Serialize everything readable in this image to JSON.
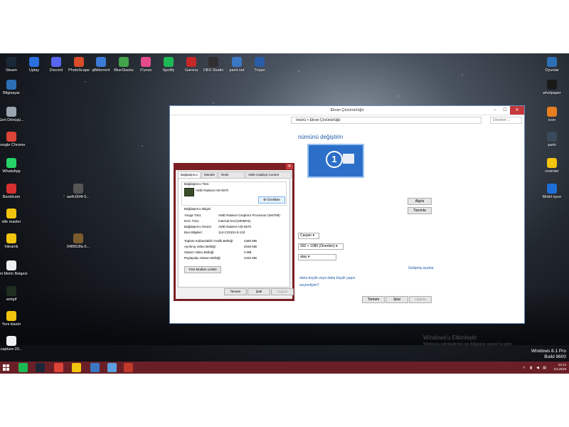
{
  "desktop": {
    "top_icons": [
      {
        "label": "Steam",
        "color": "#1b2838"
      },
      {
        "label": "Uplay",
        "color": "#2a6fdb"
      },
      {
        "label": "Discord",
        "color": "#5865f2"
      },
      {
        "label": "PhotoScape",
        "color": "#d94c2a"
      },
      {
        "label": "qBittorrent",
        "color": "#3a7bd5"
      },
      {
        "label": "BlueStacks",
        "color": "#44a34a"
      },
      {
        "label": "iTunes",
        "color": "#e54b8c"
      },
      {
        "label": "Spotify",
        "color": "#1db954"
      },
      {
        "label": "Garena",
        "color": "#c62828"
      },
      {
        "label": "OBS Studio",
        "color": "#302e31"
      },
      {
        "label": "paint.net",
        "color": "#3b78c4"
      },
      {
        "label": "Trojan",
        "color": "#2a5ca8"
      }
    ],
    "left_icons": [
      {
        "label": "Bilgisayar",
        "color": "#2d6fb5"
      },
      {
        "label": "Geri Dönüşü...",
        "color": "#9aa5b1"
      },
      {
        "label": "Google Chrome",
        "color": "#db4437"
      },
      {
        "label": "WhatsApp",
        "color": "#25d366"
      },
      {
        "label": "Bandicam",
        "color": "#d63031"
      },
      {
        "label": "idle master",
        "color": "#f1c40f"
      },
      {
        "label": "hileamk",
        "color": "#f1c40f"
      },
      {
        "label": "Yeni Metin Belgesi",
        "color": "#ecf0f1"
      },
      {
        "label": "amigif",
        "color": "#1f2d1f"
      },
      {
        "label": "Yeni klasör",
        "color": "#f1c40f"
      },
      {
        "label": "capture-20...",
        "color": "#ecf0f1"
      }
    ],
    "middle_icons": [
      {
        "label": "aa4c004f-5...",
        "color": "#555555"
      },
      {
        "label": "048653fa-0...",
        "color": "#7a5c2e"
      }
    ],
    "right_icons": [
      {
        "label": "Oyunlar",
        "color": "#2d6fb5"
      },
      {
        "label": "whelpaper",
        "color": "#1a1a1a"
      },
      {
        "label": "icon",
        "color": "#e67e22"
      },
      {
        "label": "şarkı",
        "color": "#3b4a5a"
      },
      {
        "label": "resimler",
        "color": "#f1c40f"
      },
      {
        "label": "Mobil oyun",
        "color": "#1e6fd9"
      }
    ]
  },
  "main_window": {
    "title": "Ekran Çözünürlüğü",
    "path": "önünü  >  Ekran Çözünürlüğü",
    "search_placeholder": "Denetim ...",
    "heading": "nümünü değiştirin",
    "monitor_number": "1",
    "detect_button": "Algıla",
    "identify_button": "Tanımla",
    "display_select": "Casper",
    "resolution_select": "920 × 1080 (Önerilen)",
    "orientation_select": "atay",
    "advanced_link": "Gelişmiş ayarlar",
    "link1": "daha büyük veya daha küçük yapın",
    "link2": "seçmeliyim?",
    "ok": "Tamam",
    "cancel": "İptal",
    "apply": "Uygula",
    "watermark_title": "Windows'u Etkinleştir",
    "watermark_sub": "Windows'u etkinleştirmek için Bilgisayar ayarları'na gidin.",
    "os_name": "Windows 8.1 Pro",
    "os_build": "Build 9600"
  },
  "dialog": {
    "tabs": [
      "Bağdaştırıcı",
      "Monitör",
      "Renk Yönetimi",
      "AMD Catalyst Control Center"
    ],
    "adapter_type_label": "Bağdaştırıcı Türü",
    "adapter_name": "AMD Radeon HD 6570",
    "properties_button": "Özellikler",
    "info_label": "Bağdaştırıcı Bilgisi",
    "info_rows": [
      {
        "k": "Yonga Türü:",
        "v": "AMD Radeon Graphics Processor (0x6759)"
      },
      {
        "k": "DAC Türü:",
        "v": "Internal DAC(400MHz)"
      },
      {
        "k": "Bağdaştırıcı Dizesi:",
        "v": "AMD Radeon HD 6570"
      },
      {
        "k": "Bios Bilgileri:",
        "v": "113-C33101-9.102"
      }
    ],
    "mem_rows": [
      {
        "k": "Toplam Kullanılabilir Grafik Belleği:",
        "v": "4480 MB"
      },
      {
        "k": "Ayrılmış Video Belleği:",
        "v": "2048 MB"
      },
      {
        "k": "Sistem Video Belleği:",
        "v": "0 MB"
      },
      {
        "k": "Paylaşılan Sistem Belleği:",
        "v": "2432 MB"
      }
    ],
    "list_modes_button": "Tüm Modları Listele",
    "ok": "Tamam",
    "cancel": "İptal",
    "apply": "Uygula"
  },
  "taskbar": {
    "apps": [
      {
        "name": "spotify",
        "color": "#1db954"
      },
      {
        "name": "steam",
        "color": "#1b2838"
      },
      {
        "name": "chrome",
        "color": "#db4437"
      },
      {
        "name": "file-explorer",
        "color": "#f1c40f"
      },
      {
        "name": "control-panel",
        "color": "#3b78c4"
      },
      {
        "name": "display-settings",
        "color": "#5aa0e0"
      },
      {
        "name": "opera",
        "color": "#c0392b"
      }
    ],
    "time": "22:14",
    "date": "3.5.2018"
  }
}
